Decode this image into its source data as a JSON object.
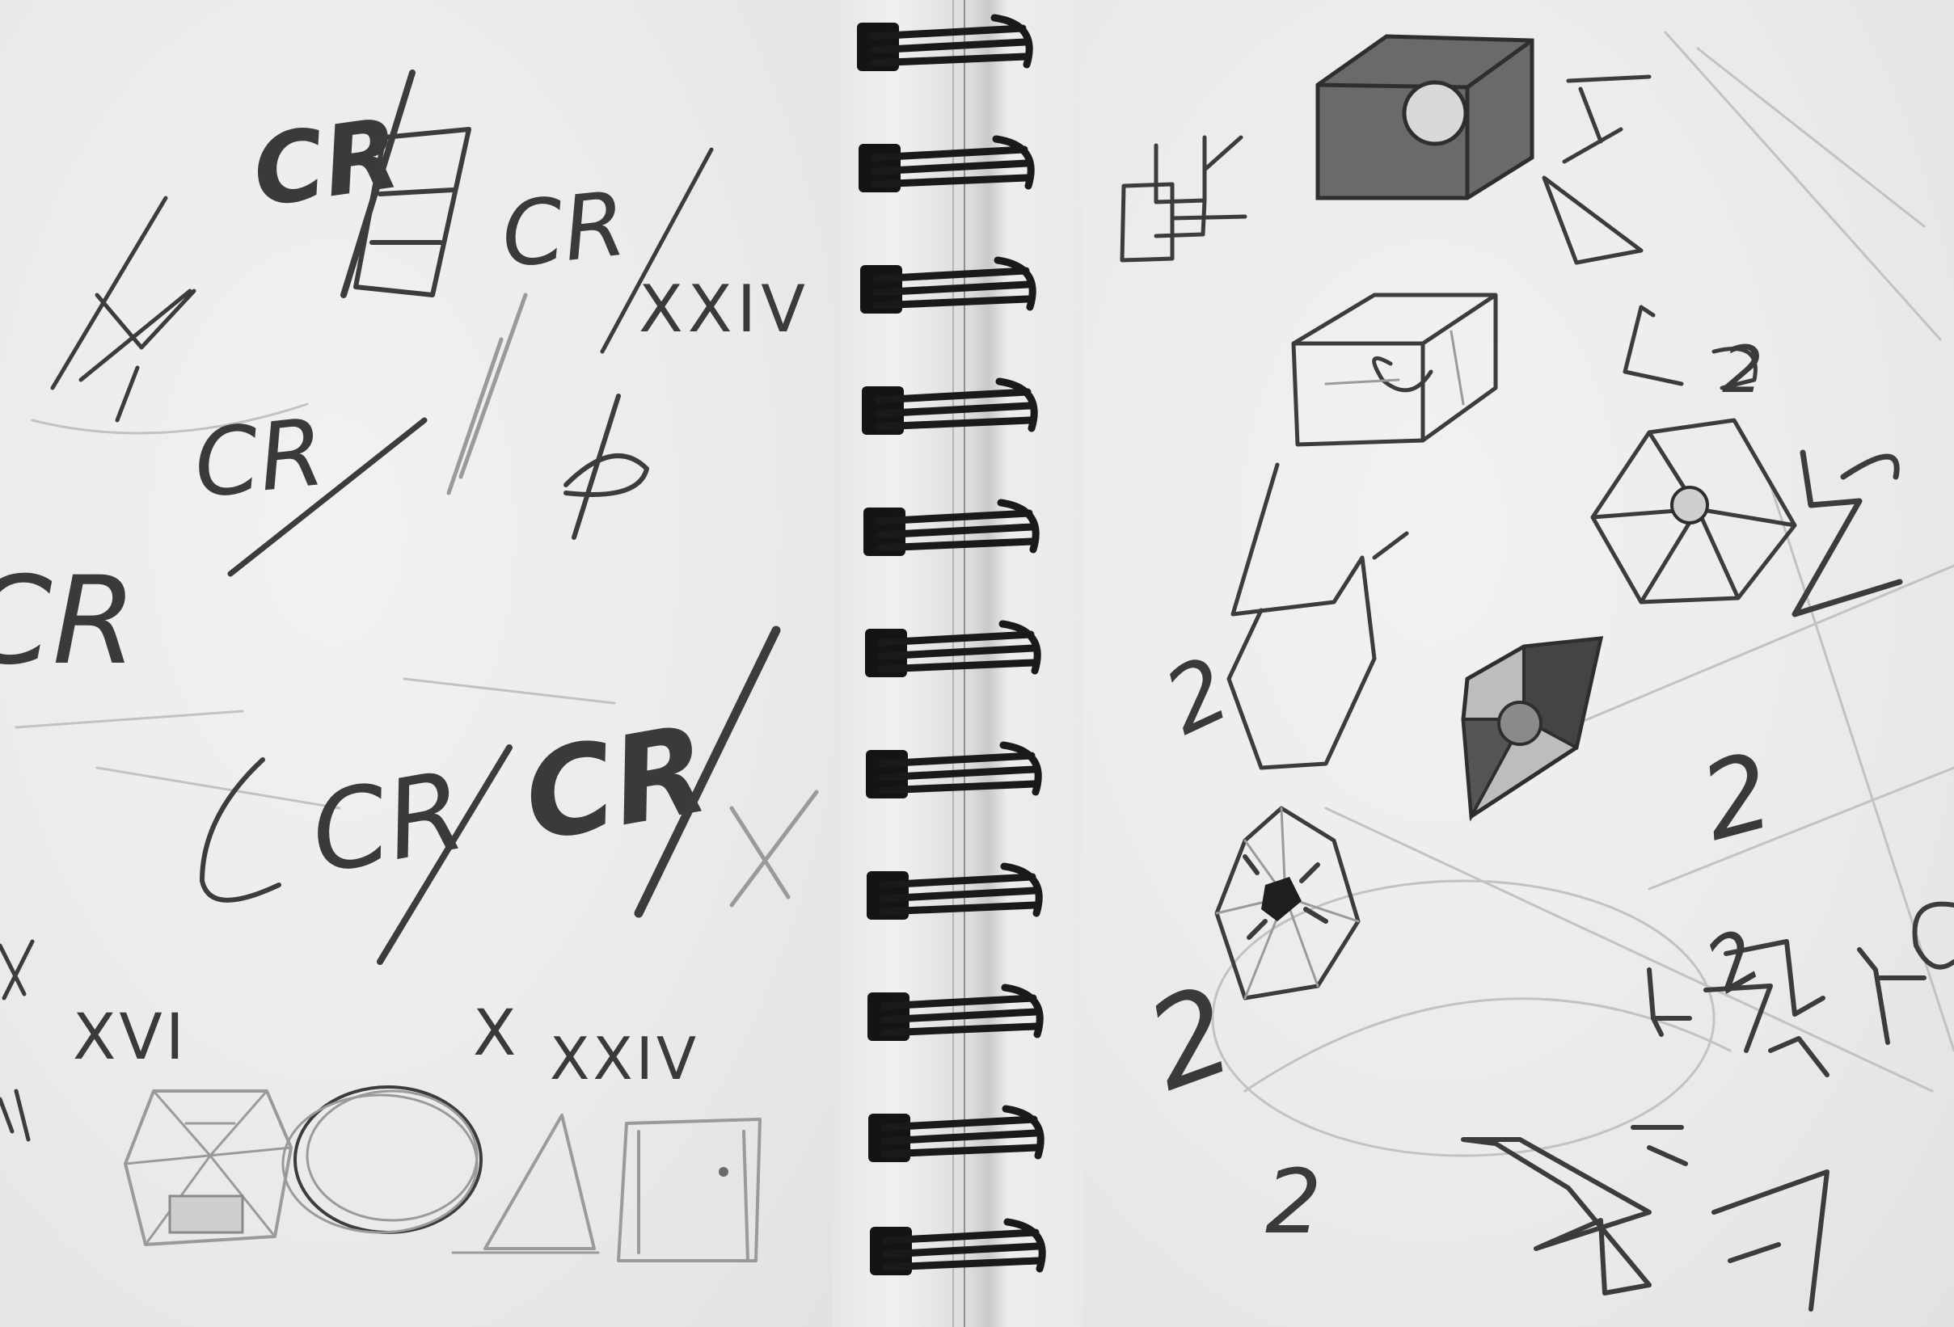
{
  "scene": {
    "colors": {
      "paper": "#ececec",
      "pencil": "#3c3c3c",
      "shading": "#6a6a6a",
      "spiral": "#141414"
    },
    "spiral_loops": 11
  },
  "left_page": {
    "marks": [
      "CR",
      "CR",
      "XXIV",
      "CR",
      "CR",
      "CR",
      "CR",
      "XVI",
      "X",
      "XXIV"
    ]
  },
  "right_page": {
    "marks": [
      "2",
      "2",
      "2",
      "2",
      "2",
      "2"
    ]
  }
}
